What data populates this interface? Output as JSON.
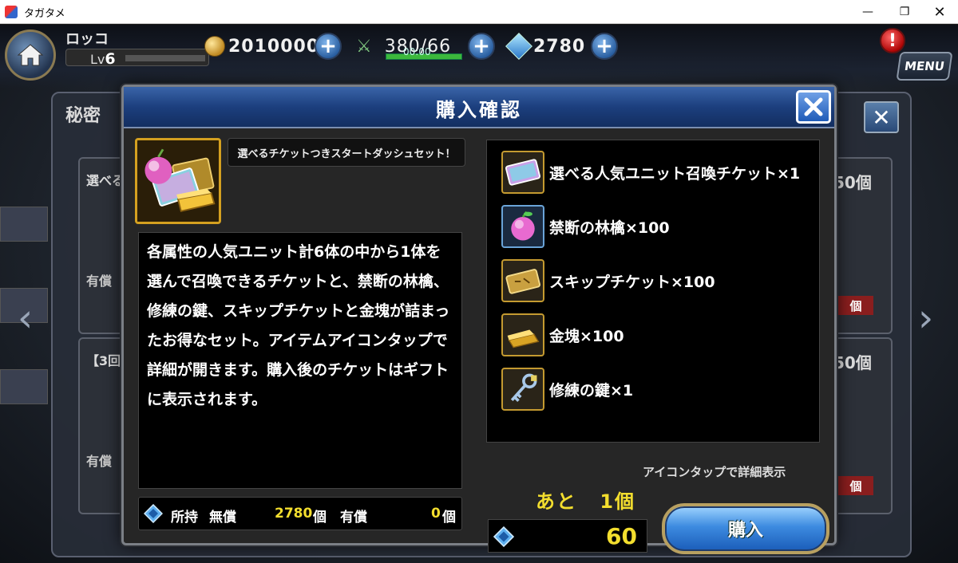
{
  "window": {
    "title": "タガタメ"
  },
  "hud": {
    "player_name": "ロッコ",
    "level_prefix": "Lv",
    "level": "6",
    "gold": "2010000",
    "stamina": "380/66",
    "stamina_timer": "00:00",
    "gems": "2780",
    "menu_label": "MENU",
    "notice": "!"
  },
  "background": {
    "panel_title": "秘密",
    "card1_label": "選べる",
    "card1_count": "50個",
    "card1_tag": "有償",
    "card1_badge": "個",
    "card2_label": "【3回",
    "card2_count": "50個",
    "card2_tag": "有償",
    "card2_badge": "個"
  },
  "dialog": {
    "title": "購入確認",
    "product_name": "選べるチケットつきスタートダッシュセット！",
    "description": "各属性の人気ユニット計6体の中から1体を選んで召喚できるチケットと、禁断の林檎、修練の鍵、スキップチケットと金塊が詰まったお得なセット。アイテムアイコンタップで詳細が開きます。購入後のチケットはギフトに表示されます。",
    "items": [
      {
        "label": "選べる人気ユニット召喚チケット×1",
        "icon": "ticket-rainbow-icon"
      },
      {
        "label": "禁断の林檎×100",
        "icon": "apple-icon"
      },
      {
        "label": "スキップチケット×100",
        "icon": "skip-ticket-icon"
      },
      {
        "label": "金塊×100",
        "icon": "gold-bar-icon"
      },
      {
        "label": "修練の鍵×1",
        "icon": "key-icon"
      }
    ],
    "hint": "アイコンタップで詳細表示",
    "remain_prefix": "あと",
    "remain_count": "1個",
    "owned": {
      "label": "所持",
      "free_label": "無償",
      "free_value": "2780",
      "free_unit": "個",
      "paid_label": "有償",
      "paid_value": "0",
      "paid_unit": "個"
    },
    "price": "60",
    "buy_label": "購入"
  },
  "colors": {
    "accent_yellow": "#f3de2e",
    "header_blue": "#1c3f7e",
    "frame_gold": "#c49a30"
  }
}
